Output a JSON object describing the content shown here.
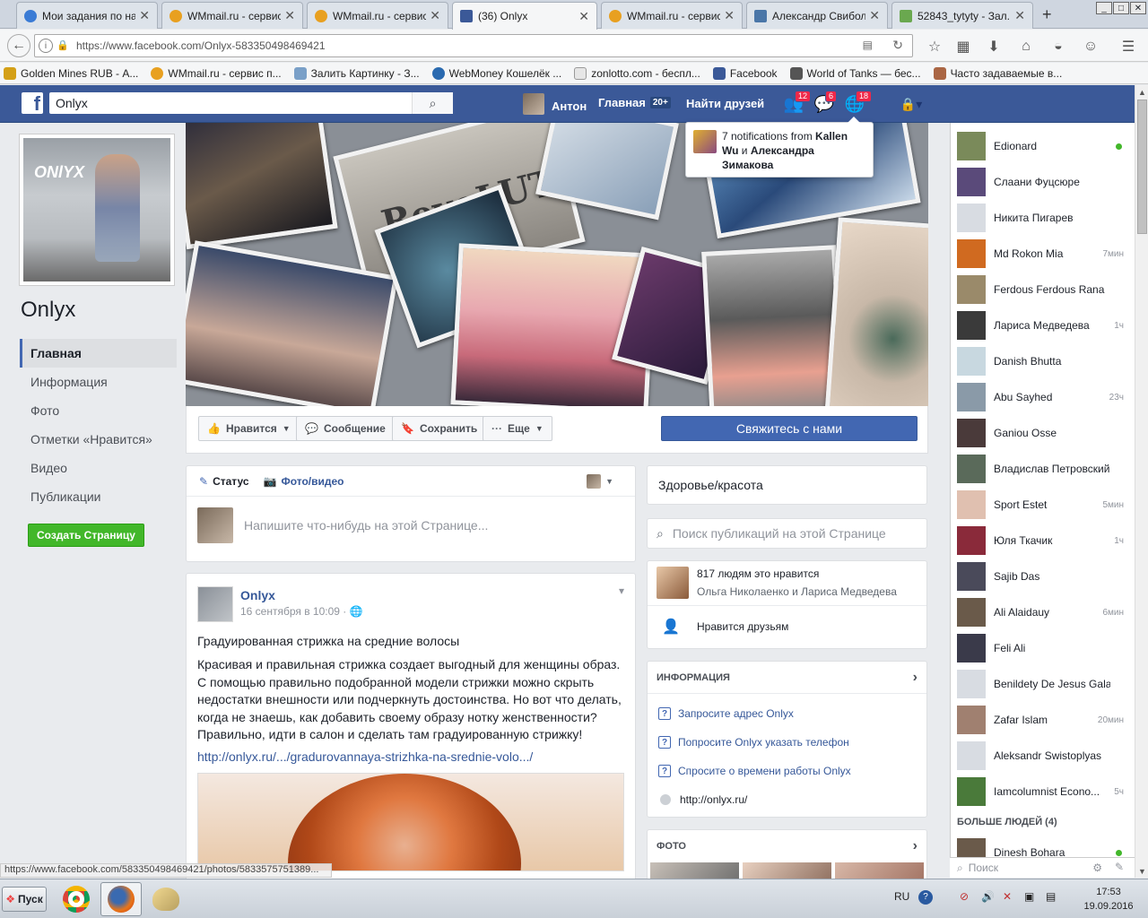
{
  "browser": {
    "tabs": [
      {
        "title": "Мои задания по на...",
        "color": "#3a7bd5",
        "active": false
      },
      {
        "title": "WMmail.ru - сервис ...",
        "color": "#e8a020",
        "active": false
      },
      {
        "title": "WMmail.ru - сервис ...",
        "color": "#e8a020",
        "active": false
      },
      {
        "title": "(36) Onlyx",
        "color": "#3b5998",
        "active": true
      },
      {
        "title": "WMmail.ru - сервис ...",
        "color": "#e8a020",
        "active": false
      },
      {
        "title": "Александр Свибола",
        "color": "#4a76a8",
        "active": false
      },
      {
        "title": "52843_tytyty - Зал...",
        "color": "#6aa84f",
        "active": false
      }
    ],
    "url": "https://www.facebook.com/Onlyx-583350498469421",
    "bookmarks": [
      {
        "label": "Golden Mines RUB - А...",
        "color": "#d4a017"
      },
      {
        "label": "WMmail.ru - сервис п...",
        "color": "#e8a020"
      },
      {
        "label": "Залить Картинку - З...",
        "color": "#7aa0c8"
      },
      {
        "label": "WebMoney Кошелёк ...",
        "color": "#2a6ab0"
      },
      {
        "label": "zonlotto.com - беспл...",
        "color": "#888888"
      },
      {
        "label": "Facebook",
        "color": "#3b5998"
      },
      {
        "label": "World of Tanks — бес...",
        "color": "#555555"
      },
      {
        "label": "Часто задаваемые в...",
        "color": "#aa6644"
      }
    ]
  },
  "fb": {
    "search_value": "Onlyx",
    "user_name": "Антон",
    "home_label": "Главная",
    "home_count": "20+",
    "find_friends": "Найти друзей",
    "badges": {
      "friends": "12",
      "messages": "6",
      "notifications": "18"
    },
    "notification_popup": {
      "prefix": "7 notifications from ",
      "name1": "Kallen Wu",
      "connector": " и ",
      "name2": "Александра Зимакова"
    }
  },
  "page": {
    "name": "Onlyx",
    "profile_logo_text": "ONlYX",
    "nav": [
      {
        "label": "Главная",
        "active": true
      },
      {
        "label": "Информация",
        "active": false
      },
      {
        "label": "Фото",
        "active": false
      },
      {
        "label": "Отметки «Нравится»",
        "active": false
      },
      {
        "label": "Видео",
        "active": false
      },
      {
        "label": "Публикации",
        "active": false
      }
    ],
    "create_page": "Создать Страницу",
    "cover_text": "RevoLUTION",
    "actions": {
      "like": "Нравится",
      "message": "Сообщение",
      "save": "Сохранить",
      "more": "Еще",
      "contact": "Свяжитесь с нами"
    }
  },
  "composer": {
    "status_tab": "Статус",
    "photo_tab": "Фото/видео",
    "placeholder": "Напишите что-нибудь на этой Странице..."
  },
  "post": {
    "author": "Onlyx",
    "date": "16 сентября в 10:09 · ",
    "title": "Градуированная стрижка на средние волосы",
    "body": "Красивая и правильная стрижка создает выгодный для женщины образ. С помощью правильно подобранной модели стрижки можно скрыть недостатки внешности или подчеркнуть достоинства. Но вот что делать, когда не знаешь, как добавить своему образу нотку женственности? Правильно, идти в салон и сделать там градуированную стрижку!",
    "link": "http://onlyx.ru/.../gradurovannaya-strizhka-na-srednie-volo.../"
  },
  "sidebar_right": {
    "category": "Здоровье/красота",
    "search_placeholder": "Поиск публикаций на этой Странице",
    "likes_count": "817 людям это нравится",
    "likes_friends": "Ольга Николаенко и Лариса Медведева",
    "friends_like": "Нравится друзьям",
    "info_title": "ИНФОРМАЦИЯ",
    "info_items": [
      "Запросите адрес Onlyx",
      "Попросите Onlyx указать телефон",
      "Спросите о времени работы Onlyx"
    ],
    "website": "http://onlyx.ru/",
    "photos_title": "ФОТО"
  },
  "chat": {
    "contacts": [
      {
        "name": "Edionard",
        "time": "",
        "online": true,
        "color": "#7a8a5a"
      },
      {
        "name": "Слаани Фуцсюре",
        "time": "",
        "online": false,
        "color": "#5a4a7a"
      },
      {
        "name": "Никита Пигарев",
        "time": "",
        "online": false,
        "color": "#d8dce2"
      },
      {
        "name": "Md Rokon Mia",
        "time": "7мин",
        "online": false,
        "color": "#d06a20"
      },
      {
        "name": "Ferdous Ferdous Rana",
        "time": "",
        "online": false,
        "color": "#9a8a6a"
      },
      {
        "name": "Лариса Медведева",
        "time": "1ч",
        "online": false,
        "color": "#3a3a3a"
      },
      {
        "name": "Danish Bhutta",
        "time": "",
        "online": false,
        "color": "#c8d8e0"
      },
      {
        "name": "Abu Sayhed",
        "time": "23ч",
        "online": false,
        "color": "#8a9aa8"
      },
      {
        "name": "Ganiou Osse",
        "time": "",
        "online": false,
        "color": "#4a3a3a"
      },
      {
        "name": "Владислав Петровский",
        "time": "",
        "online": false,
        "color": "#5a6a5a"
      },
      {
        "name": "Sport Estet",
        "time": "5мин",
        "online": false,
        "color": "#e0c0b0"
      },
      {
        "name": "Юля Ткачик",
        "time": "1ч",
        "online": false,
        "color": "#8a2a3a"
      },
      {
        "name": "Sajib Das",
        "time": "",
        "online": false,
        "color": "#4a4a5a"
      },
      {
        "name": "Ali Alaidauy",
        "time": "6мин",
        "online": false,
        "color": "#6a5a4a"
      },
      {
        "name": "Feli Ali",
        "time": "",
        "online": false,
        "color": "#3a3a4a"
      },
      {
        "name": "Benildety De Jesus Galaxi...",
        "time": "",
        "online": false,
        "color": "#d8dce2"
      },
      {
        "name": "Zafar Islam",
        "time": "20мин",
        "online": false,
        "color": "#a08070"
      },
      {
        "name": "Aleksandr Swistoplyas",
        "time": "",
        "online": false,
        "color": "#d8dce2"
      },
      {
        "name": "Iamcolumnist Econo...",
        "time": "5ч",
        "online": false,
        "color": "#4a7a3a"
      }
    ],
    "more_people": "БОЛЬШЕ ЛЮДЕЙ (4)",
    "next_contact": {
      "name": "Dinesh Bohara",
      "online": true,
      "color": "#6a5a4a"
    },
    "search_placeholder": "Поиск"
  },
  "status_url": "https://www.facebook.com/583350498469421/photos/5833575751389...",
  "taskbar": {
    "start": "Пуск",
    "lang": "RU",
    "time": "17:53",
    "date": "19.09.2016"
  },
  "colors": {
    "fb_blue": "#3b5998",
    "button_blue": "#4267b2",
    "green": "#42b72a",
    "badge_red": "#f02849"
  }
}
